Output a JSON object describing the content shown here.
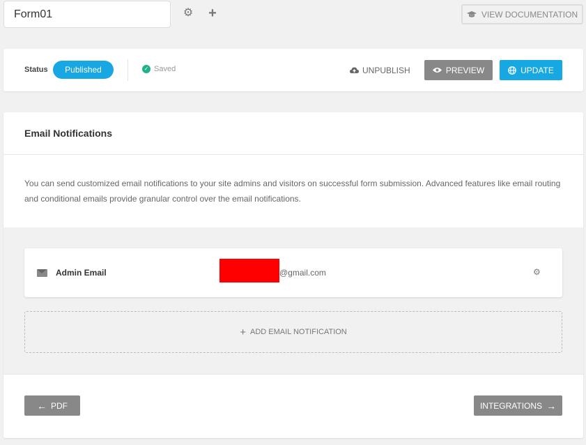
{
  "header": {
    "form_name": "Form01",
    "doc_button_label": "VIEW DOCUMENTATION"
  },
  "status_bar": {
    "status_label": "Status",
    "status_value": "Published",
    "saved_label": "Saved",
    "unpublish_label": "UNPUBLISH",
    "preview_label": "PREVIEW",
    "update_label": "UPDATE"
  },
  "email_section": {
    "title": "Email Notifications",
    "description": "You can send customized email notifications to your site admins and visitors on successful form submission. Advanced features like email routing and conditional emails provide granular control over the email notifications.",
    "notifications": [
      {
        "name": "Admin Email",
        "email_visible": "@gmail.com"
      }
    ],
    "add_label": "ADD EMAIL NOTIFICATION"
  },
  "footer_nav": {
    "prev_label": "PDF",
    "next_label": "INTEGRATIONS"
  },
  "colors": {
    "accent": "#17a8e3",
    "neutral_button": "#888888",
    "saved_green": "#1fb28a",
    "redaction": "#ff0000"
  },
  "icons": [
    "gear-icon",
    "plus-icon",
    "graduation-cap-icon",
    "check-circle-icon",
    "cloud-upload-icon",
    "eye-icon",
    "globe-icon",
    "envelope-icon",
    "arrow-left-icon",
    "arrow-right-icon"
  ]
}
